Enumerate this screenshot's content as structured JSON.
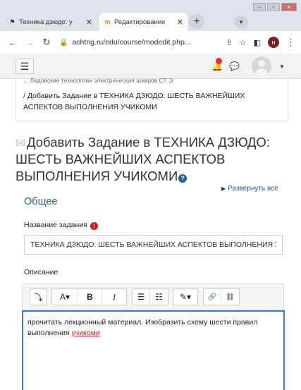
{
  "browser": {
    "tabs": [
      {
        "label": "Техника дзюдо: у",
        "active": false
      },
      {
        "label": "Редактирование",
        "active": true
      }
    ],
    "url": "achtng.ru/edu/course/modedit.php...",
    "profile_initial": "н"
  },
  "breadcrumb": {
    "prev": "... Ладовские технологии электрическая шивров СТ Э",
    "current": "/ Добавить Задание в ТЕХНИКА ДЗЮДО: ШЕСТЬ ВАЖНЕЙШИХ АСПЕКТОВ ВЫПОЛНЕНИЯ УЧИКОМИ"
  },
  "page": {
    "title": "Добавить Задание в ТЕХНИКА ДЗЮДО: ШЕСТЬ ВАЖНЕЙШИХ АСПЕКТОВ ВЫПОЛНЕНИЯ УЧИКОМИ",
    "expand_all": "Развернуть всё",
    "section_general": "Общее",
    "name_label": "Название задания",
    "name_value": "ТЕХНИКА ДЗЮДО: ШЕСТЬ ВАЖНЕЙШИХ АСПЕКТОВ ВЫПОЛНЕНИЯ УЧИКОМИ",
    "description_label": "Описание",
    "description_text": "прочитать лекционный материал. Изобразить схему шести правил выполнения",
    "description_underlined": "учикоми"
  },
  "toolbar": {
    "expand": "⤵",
    "font": "A▾",
    "bold": "B",
    "italic": "I",
    "ul": "☰",
    "ol": "☷",
    "style": "✎▾",
    "link": "🔗",
    "unlink": "⛓"
  },
  "icons": {
    "accent": "#1f5c99",
    "required": "#c81e1e",
    "editor_border": "#3a7fc4"
  }
}
